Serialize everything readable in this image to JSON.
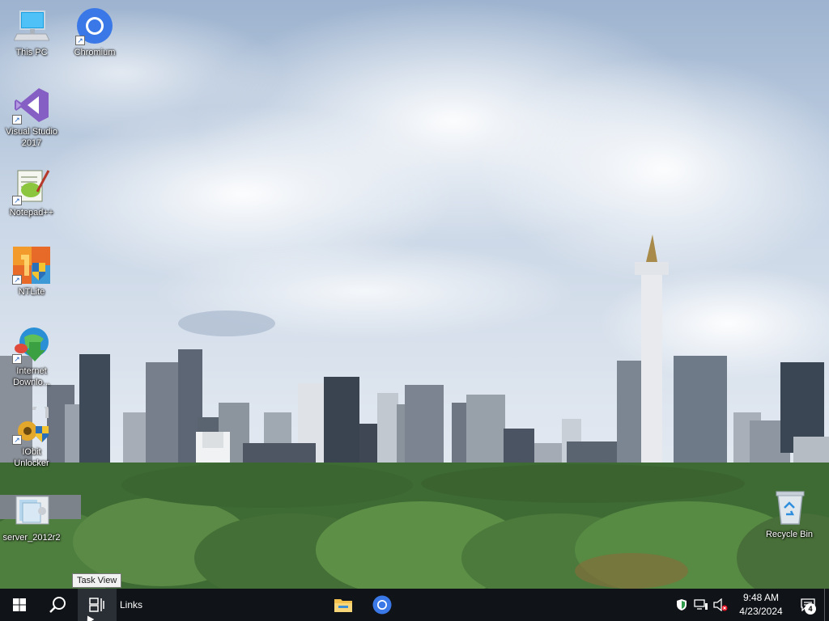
{
  "desktop": {
    "icons": [
      {
        "id": "this-pc",
        "label": "This PC",
        "icon": "computer-icon"
      },
      {
        "id": "chromium",
        "label": "Chromium",
        "icon": "chromium-icon"
      },
      {
        "id": "visual-studio",
        "label": "Visual Studio\n2017",
        "icon": "visual-studio-icon"
      },
      {
        "id": "notepad-pp",
        "label": "Notepad++",
        "icon": "notepad-plus-plus-icon"
      },
      {
        "id": "ntlite",
        "label": "NTLite",
        "icon": "ntlite-icon"
      },
      {
        "id": "idm",
        "label": "Internet\nDownlo...",
        "icon": "internet-download-manager-icon"
      },
      {
        "id": "iobit",
        "label": "IObit\nUnlocker",
        "icon": "iobit-unlocker-icon"
      },
      {
        "id": "server",
        "label": "server_2012r2",
        "icon": "disc-image-icon"
      },
      {
        "id": "recycle-bin",
        "label": "Recycle Bin",
        "icon": "recycle-bin-icon"
      }
    ]
  },
  "tooltip": {
    "text": "Task View"
  },
  "taskbar": {
    "start_icon": "windows-logo-icon",
    "search_icon": "search-icon",
    "task_view_icon": "task-view-icon",
    "links_label": "Links",
    "pinned": [
      {
        "name": "file-explorer",
        "icon": "folder-icon"
      },
      {
        "name": "chromium",
        "icon": "chromium-icon"
      }
    ],
    "tray": {
      "icons": [
        "security-shield-icon",
        "network-icon",
        "volume-muted-icon"
      ],
      "time": "9:48 AM",
      "date": "4/23/2024",
      "notification_count": "4"
    }
  },
  "colors": {
    "taskbar_bg": "#101418",
    "chromium_blue": "#3b78e7",
    "folder_yellow": "#f2c14e"
  }
}
